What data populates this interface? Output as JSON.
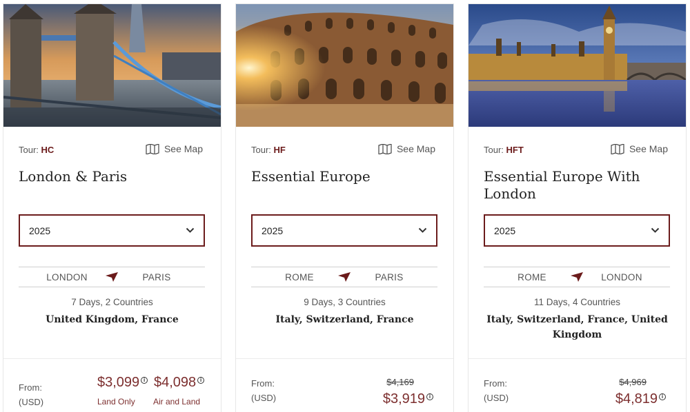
{
  "tour_prefix": "Tour:",
  "see_map_label": "See Map",
  "from_label": "From:",
  "currency_label": "(USD)",
  "colors": {
    "accent": "#6b1b1b",
    "price": "#7c2e2e",
    "border": "#e6e6e6"
  },
  "cards": [
    {
      "image": "tower-bridge-london-photo",
      "code": "HC",
      "title": "London & Paris",
      "year": "2025",
      "route_from": "LONDON",
      "route_to": "PARIS",
      "duration": "7 Days, 2 Countries",
      "countries": "United Kingdom, France",
      "price_land": "$3,099",
      "price_land_label": "Land Only",
      "price_air": "$4,098",
      "price_air_label": "Air and Land"
    },
    {
      "image": "colosseum-rome-photo",
      "code": "HF",
      "title": "Essential Europe",
      "year": "2025",
      "route_from": "ROME",
      "route_to": "PARIS",
      "duration": "9 Days, 3 Countries",
      "countries": "Italy, Switzerland, France",
      "old_price": "$4,169",
      "price": "$3,919"
    },
    {
      "image": "big-ben-parliament-photo",
      "code": "HFT",
      "title": "Essential Europe With London",
      "year": "2025",
      "route_from": "ROME",
      "route_to": "LONDON",
      "duration": "11 Days, 4 Countries",
      "countries": "Italy, Switzerland, France, United Kingdom",
      "old_price": "$4,969",
      "price": "$4,819"
    }
  ]
}
